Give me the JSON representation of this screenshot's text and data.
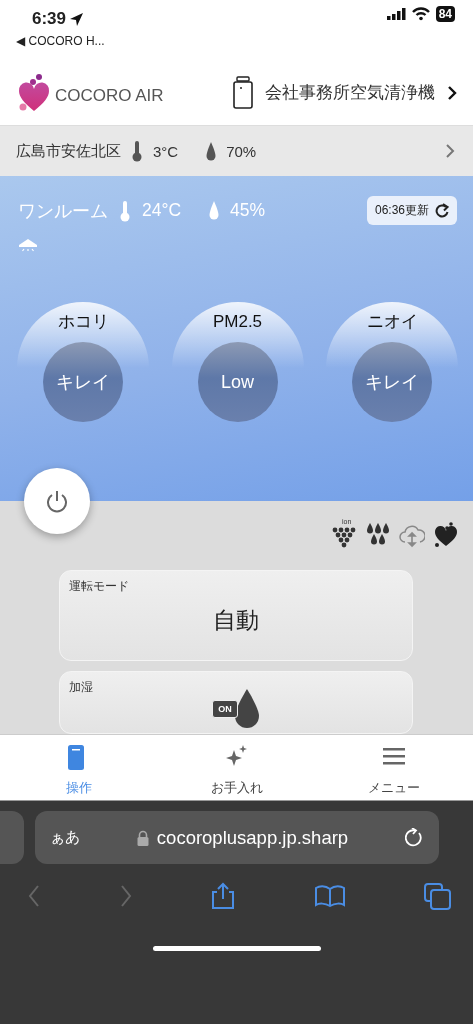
{
  "status_bar": {
    "time": "6:39",
    "back_label": "◀ COCORO H...",
    "battery": "84"
  },
  "header": {
    "brand": "COCORO AIR",
    "device_name": "会社事務所空気清浄機"
  },
  "outdoor": {
    "location": "広島市安佐北区",
    "temperature": "3°C",
    "humidity": "70%"
  },
  "room": {
    "name": "ワンルーム",
    "temperature": "24°C",
    "humidity": "45%",
    "updated": "06:36更新"
  },
  "sensors": [
    {
      "label": "ホコリ",
      "value": "キレイ"
    },
    {
      "label": "PM2.5",
      "value": "Low"
    },
    {
      "label": "ニオイ",
      "value": "キレイ"
    }
  ],
  "status_icons": {
    "ion_label": "ion"
  },
  "controls": [
    {
      "kind": "mode",
      "label": "運転モード",
      "value": "自動"
    },
    {
      "kind": "toggle",
      "label": "加湿",
      "on": true,
      "badge": "ON"
    }
  ],
  "tabs": [
    {
      "label": "操作",
      "selected": true
    },
    {
      "label": "お手入れ",
      "selected": false
    },
    {
      "label": "メニュー",
      "selected": false
    }
  ],
  "browser": {
    "text_size": "ぁあ",
    "url": "cocoroplusapp.jp.sharp"
  }
}
